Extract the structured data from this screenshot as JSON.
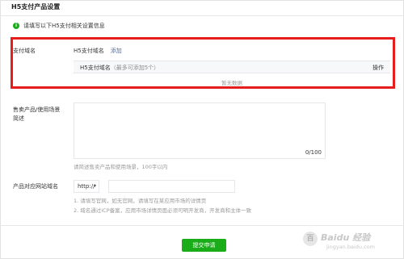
{
  "page": {
    "title": "H5支付产品设置"
  },
  "notice": {
    "text": "请填写以下H5支付相关设置信息"
  },
  "domain_section": {
    "label": "支付域名",
    "heading": "H5支付域名",
    "add_link": "添加",
    "table": {
      "col_domain": "H5支付域名",
      "col_domain_hint": "（最多可添加5个）",
      "col_op": "操作",
      "empty": "暂无数据"
    }
  },
  "desc_section": {
    "label_line1": "售卖产品/使用场景",
    "label_line2": "简述",
    "counter": "0/100",
    "tip": "请简述售卖产品和使用场景，100字以内"
  },
  "site_section": {
    "label": "产品对应网站域名",
    "protocol": "http://",
    "url_value": "",
    "tip1": "1. 请填写官网，如无官网，请填写在某应用市场的详情页",
    "tip2": "2. 域名通过ICP备案，应用市场详情页面必须可明开发商，开发商和主体一致"
  },
  "submit": {
    "label": "提交申请"
  },
  "watermark": {
    "badge": "百",
    "text": "Baidu 经验",
    "url": "jingyan.baidu.com"
  }
}
